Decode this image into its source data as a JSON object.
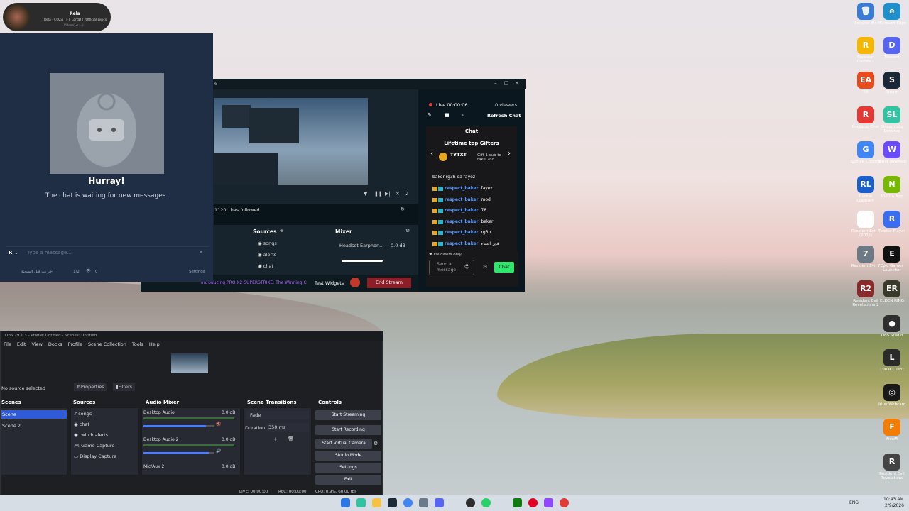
{
  "media_player": {
    "title": "Rela",
    "subtitle": "Rela - COZA | FT. LordD | rOfficial Lyrics",
    "extra": "Videos(مشاهد)"
  },
  "chat_panel": {
    "heading": "Hurray!",
    "message": "The chat is waiting for new messages.",
    "input_placeholder": "Type a message...",
    "footer_name": "اخر بث قبل السجنة",
    "footer_count": "1/2",
    "footer_viewers": "0",
    "settings_label": "Settings"
  },
  "streamlabs": {
    "live_time": "Live 00:00:06",
    "viewers": "0 viewers",
    "refresh_chat": "Refresh Chat",
    "chat_title": "Chat",
    "gifters_title": "Lifetime top Gifters",
    "gifter_name": "TYTXT",
    "gift_text": "Gift 1 sub to take 2nd",
    "chat_lines": [
      {
        "user": "",
        "msg": "baker rg3h ea fayez"
      },
      {
        "user": "respect_baker",
        "msg": ": fayez"
      },
      {
        "user": "respect_baker",
        "msg": ": mod"
      },
      {
        "user": "respect_baker",
        "msg": ": 78"
      },
      {
        "user": "respect_baker",
        "msg": ": baker"
      },
      {
        "user": "respect_baker",
        "msg": ": rg3h"
      },
      {
        "user": "respect_baker",
        "msg": ": فايز اعتناء"
      }
    ],
    "followers_only": "Followers only",
    "send_placeholder": "Send a message",
    "chat_button": "Chat",
    "follow_event": "1120   has followed",
    "sources_label": "Sources",
    "mixer_label": "Mixer",
    "sources": [
      "songs",
      "alerts",
      "chat"
    ],
    "mixer_device": "Headset Earphon...",
    "mixer_db": "0.0 dB",
    "ticker": "Introducing PRO X2 SUPERSTRIKE: The Winning C",
    "test_widgets": "Test Widgets",
    "end_stream": "End Stream",
    "slider": "0.8"
  },
  "obs": {
    "title": "OBS 29.1.3 - Profile: Untitled - Scenes: Untitled",
    "menu": [
      "File",
      "Edit",
      "View",
      "Docks",
      "Profile",
      "Scene Collection",
      "Tools",
      "Help"
    ],
    "no_source": "No source selected",
    "properties": "Properties",
    "filters": "Filters",
    "scenes_title": "Scenes",
    "scenes": [
      "Scene",
      "Scene 2"
    ],
    "sources_title": "Sources",
    "sources": [
      "songs",
      "chat",
      "twitch alerts",
      "Game Capture",
      "Display Capture"
    ],
    "mixer_title": "Audio Mixer",
    "mixer": [
      {
        "name": "Desktop Audio",
        "db": "0.0 dB",
        "level": 0.88
      },
      {
        "name": "Desktop Audio 2",
        "db": "0.0 dB",
        "level": 0.92
      },
      {
        "name": "Mic/Aux 2",
        "db": "0.0 dB",
        "level": 0.0
      }
    ],
    "transitions_title": "Scene Transitions",
    "transition": "Fade",
    "duration_label": "Duration",
    "duration": "350 ms",
    "controls_title": "Controls",
    "controls": [
      "Start Streaming",
      "Start Recording",
      "Start Virtual Camera",
      "Studio Mode",
      "Settings",
      "Exit"
    ],
    "status_live": "LIVE: 00:00:00",
    "status_rec": "REC: 00:00:00",
    "status_cpu": "CPU: 0.9%, 60.00 fps"
  },
  "desktop_icons": [
    {
      "label": "Recycle Bin",
      "color": "#3a7bd5",
      "glyph": "🗑"
    },
    {
      "label": "Microsoft Edge",
      "color": "#1f8fce",
      "glyph": "e"
    },
    {
      "label": "Rockstar Games...",
      "color": "#f5b700",
      "glyph": "R"
    },
    {
      "label": "Discord",
      "color": "#5865f2",
      "glyph": "D"
    },
    {
      "label": "EA",
      "color": "#e84a1b",
      "glyph": "EA"
    },
    {
      "label": "Steam",
      "color": "#1b2838",
      "glyph": "S"
    },
    {
      "label": "Rockstar Chat",
      "color": "#e53935",
      "glyph": "R"
    },
    {
      "label": "Streamlabs Desktop",
      "color": "#31c3a2",
      "glyph": "SL"
    },
    {
      "label": "Google Chrome",
      "color": "#4285f4",
      "glyph": "G"
    },
    {
      "label": "Wand (WeMod)",
      "color": "#6a4cff",
      "glyph": "W"
    },
    {
      "label": "Rocket League®",
      "color": "#1d5fc8",
      "glyph": "RL"
    },
    {
      "label": "NVIDIA App",
      "color": "#76b900",
      "glyph": "N"
    },
    {
      "label": "Resident Evil 4 (2005)",
      "color": "#ffffff",
      "glyph": "A"
    },
    {
      "label": "Roblox Player",
      "color": "#3b6df2",
      "glyph": "R"
    },
    {
      "label": "Resident Evil 7",
      "color": "#6c7a86",
      "glyph": "7"
    },
    {
      "label": "Epic Games Launcher",
      "color": "#111111",
      "glyph": "E"
    },
    {
      "label": "Resident Evil Revelations 2",
      "color": "#8a2b2b",
      "glyph": "R2"
    },
    {
      "label": "ELDEN RING",
      "color": "#3a3a2a",
      "glyph": "ER"
    },
    {
      "label": "OBS Studio",
      "color": "#2e2e2e",
      "glyph": "●"
    },
    {
      "label": "Lunar Client",
      "color": "#2a2a2a",
      "glyph": "L"
    },
    {
      "label": "Iriun Webcam",
      "color": "#1a1a1a",
      "glyph": "◎"
    },
    {
      "label": "FiveM",
      "color": "#f57c00",
      "glyph": "F"
    },
    {
      "label": "Resident Evil Revelations",
      "color": "#444",
      "glyph": "R"
    }
  ],
  "taskbar": {
    "lang": "ENG",
    "time": "10:43 AM",
    "date": "2/9/2026"
  }
}
